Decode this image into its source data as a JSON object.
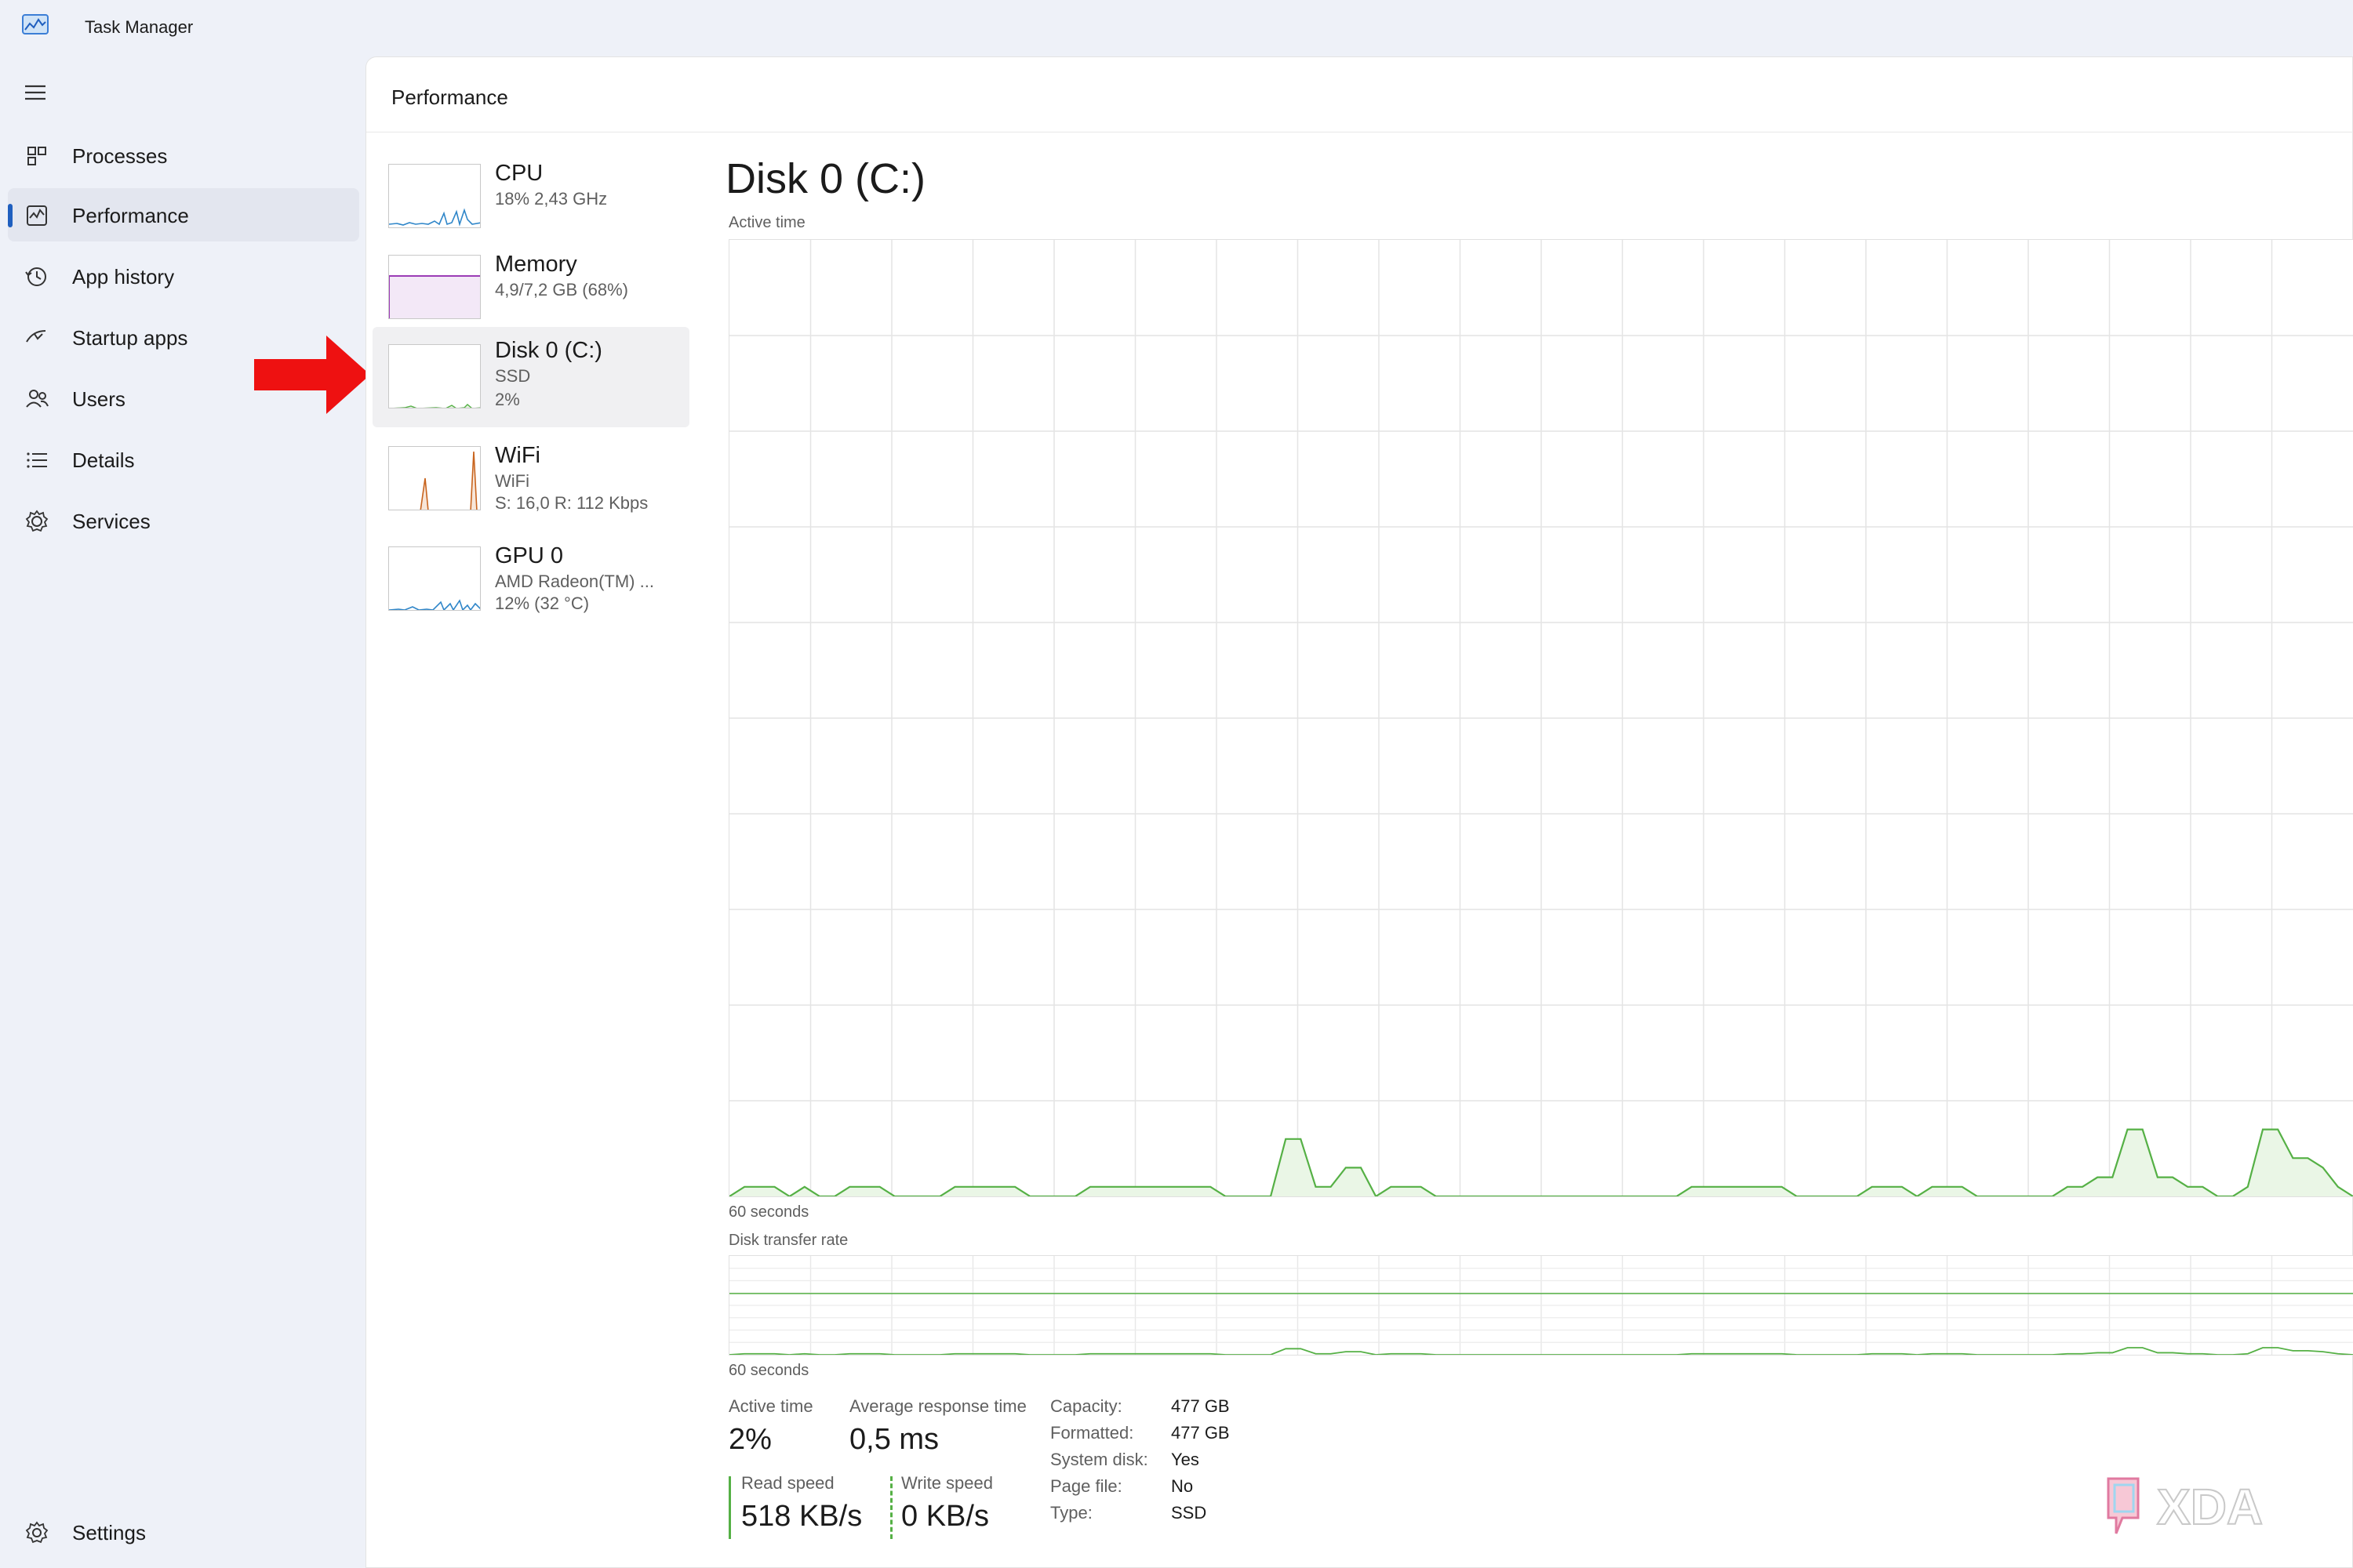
{
  "app": {
    "title": "Task Manager"
  },
  "nav": {
    "items": [
      {
        "label": "Processes",
        "icon": "processes-icon"
      },
      {
        "label": "Performance",
        "icon": "performance-icon",
        "active": true
      },
      {
        "label": "App history",
        "icon": "app-history-icon"
      },
      {
        "label": "Startup apps",
        "icon": "startup-apps-icon"
      },
      {
        "label": "Users",
        "icon": "users-icon"
      },
      {
        "label": "Details",
        "icon": "details-icon"
      },
      {
        "label": "Services",
        "icon": "services-icon"
      }
    ],
    "settings_label": "Settings"
  },
  "page": {
    "title": "Performance"
  },
  "devices": [
    {
      "name": "CPU",
      "lines": [
        "18% 2,43 GHz"
      ],
      "color": "#2f86c9"
    },
    {
      "name": "Memory",
      "lines": [
        "4,9/7,2 GB (68%)"
      ],
      "color": "#9b3cb6"
    },
    {
      "name": "Disk 0 (C:)",
      "lines": [
        "SSD",
        "2%"
      ],
      "color": "#55b045",
      "active": true
    },
    {
      "name": "WiFi",
      "lines": [
        "WiFi",
        "S: 16,0 R: 112 Kbps"
      ],
      "color": "#c8641e"
    },
    {
      "name": "GPU 0",
      "lines": [
        "AMD Radeon(TM) ...",
        "12% (32 °C)"
      ],
      "color": "#2f86c9"
    }
  ],
  "detail": {
    "title": "Disk 0 (C:)",
    "active_time_label": "Active time",
    "transfer_label": "Disk transfer rate",
    "time_span_label": "60 seconds",
    "chart_color": "#55b045"
  },
  "chart_data": {
    "type": "area",
    "series": [
      {
        "values": [
          0,
          1,
          1,
          1,
          0,
          1,
          0,
          0,
          1,
          1,
          1,
          0,
          0,
          0,
          0,
          1,
          1,
          1,
          1,
          1,
          0,
          0,
          0,
          0,
          1,
          1,
          1,
          1,
          1,
          1,
          1,
          1,
          1,
          0,
          0,
          0,
          0,
          6,
          6,
          1,
          1,
          3,
          3,
          0,
          1,
          1,
          1,
          0,
          0,
          0,
          0,
          0,
          0,
          0,
          0,
          0,
          0,
          0,
          0,
          0,
          0,
          0,
          0,
          0,
          1,
          1,
          1,
          1,
          1,
          1,
          1,
          0,
          0,
          0,
          0,
          0,
          1,
          1,
          1,
          0,
          1,
          1,
          1,
          0,
          0,
          0,
          0,
          0,
          0,
          1,
          1,
          2,
          2,
          7,
          7,
          2,
          2,
          1,
          1,
          0,
          0,
          1,
          7,
          7,
          4,
          4,
          3,
          1,
          0
        ]
      }
    ],
    "ylim": [
      0,
      100
    ]
  },
  "stats": {
    "active_time": {
      "label": "Active time",
      "value": "2%"
    },
    "avg_response": {
      "label": "Average response time",
      "value": "0,5 ms"
    },
    "read_speed": {
      "label": "Read speed",
      "value": "518 KB/s"
    },
    "write_speed": {
      "label": "Write speed",
      "value": "0 KB/s"
    }
  },
  "properties": [
    {
      "key": "Capacity:",
      "value": "477 GB"
    },
    {
      "key": "Formatted:",
      "value": "477 GB"
    },
    {
      "key": "System disk:",
      "value": "Yes"
    },
    {
      "key": "Page file:",
      "value": "No"
    },
    {
      "key": "Type:",
      "value": "SSD"
    }
  ],
  "watermark": {
    "text": "XDA"
  }
}
